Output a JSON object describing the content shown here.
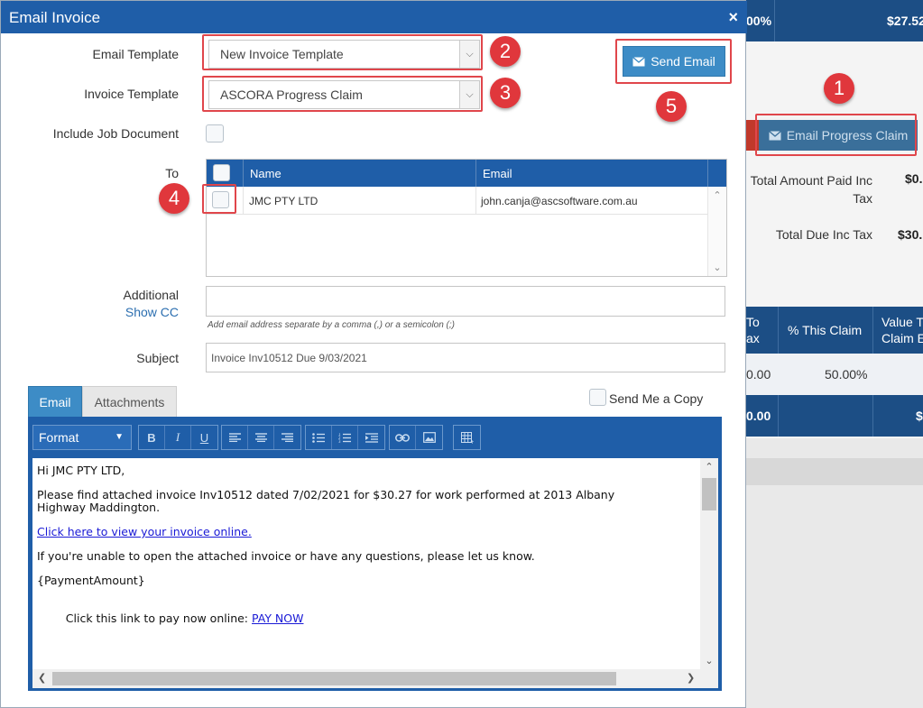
{
  "background": {
    "top_value_partial": "00%",
    "top_amount": "$27.52",
    "email_progress_claim_label": "Email Progress Claim",
    "total_paid_label": "Total Amount Paid Inc Tax",
    "total_paid_value": "$0.",
    "total_due_label": "Total Due Inc Tax",
    "total_due_value": "$30.",
    "table_headers": [
      "To\nax",
      "% This Claim",
      "Value T\nClaim E"
    ],
    "row_values": [
      "0.00",
      "50.00%",
      ""
    ],
    "total_values": [
      "0.00",
      "$"
    ]
  },
  "dialog": {
    "title": "Email Invoice",
    "close_glyph": "×",
    "email_template_label": "Email Template",
    "email_template_value": "New Invoice Template",
    "invoice_template_label": "Invoice Template",
    "invoice_template_value": "ASCORA Progress Claim",
    "include_job_doc_label": "Include Job Document",
    "send_email_label": "Send Email",
    "to_label": "To",
    "grid": {
      "headers": {
        "name": "Name",
        "email": "Email"
      },
      "rows": [
        {
          "name": "JMC PTY LTD",
          "email": "john.canja@ascsoftware.com.au"
        }
      ]
    },
    "additional_label": "Additional",
    "show_cc_label": "Show CC",
    "additional_hint": "Add email address separate by a comma (,) or a semicolon (;)",
    "subject_label": "Subject",
    "subject_value": "Invoice Inv10512 Due 9/03/2021",
    "tabs": {
      "email": "Email",
      "attachments": "Attachments"
    },
    "send_me_copy_label": "Send Me a Copy",
    "editor": {
      "format_label": "Format",
      "body": {
        "greeting": "Hi JMC PTY LTD,",
        "line1": "Please find attached invoice Inv10512 dated 7/02/2021 for $30.27 for work performed at 2013 Albany",
        "line1b": "Highway Maddington.",
        "view_link": "Click here to view your invoice online.",
        "line2": "If you're unable to open the attached invoice or have any questions, please let us know.",
        "payment_amount": "{PaymentAmount}",
        "pay_prefix": "Click this link to pay now online: ",
        "pay_link": "PAY NOW"
      }
    }
  },
  "annotations": [
    "1",
    "2",
    "3",
    "4",
    "5"
  ],
  "icons": [
    "close-icon",
    "envelope-icon",
    "chevron-down-icon",
    "checkbox-icon",
    "bold-icon",
    "italic-icon",
    "underline-icon",
    "align-left-icon",
    "align-center-icon",
    "align-right-icon",
    "bullet-list-icon",
    "numbered-list-icon",
    "indent-icon",
    "link-icon",
    "image-icon",
    "table-icon"
  ],
  "colors": {
    "header_blue": "#1f5ea8",
    "button_blue": "#3d8cc6",
    "annotation_red": "#e0373c"
  }
}
